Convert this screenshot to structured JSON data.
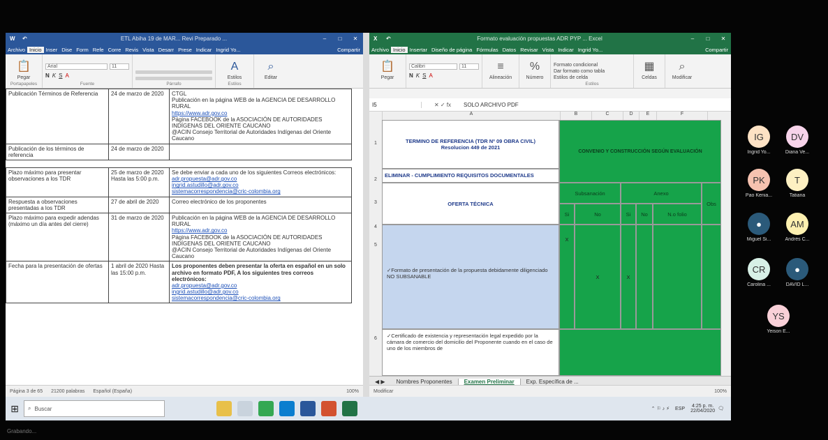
{
  "word": {
    "title": "ETL Abiha 19 de MAR... Revi Preparado ...",
    "tabs": [
      "Archivo",
      "Inicio",
      "Inser",
      "Dise",
      "Form",
      "Refe",
      "Corre",
      "Revis",
      "Vista",
      "Desarr",
      "Prese",
      "Indicar",
      "Ingrid Yo...",
      "Compartir"
    ],
    "ribbon": {
      "paste": "Pegar",
      "font": "Arial",
      "size": "11",
      "styles": "Estilos",
      "edit": "Editar",
      "clipboard": "Portapapeles",
      "font_group": "Fuente",
      "paragraph": "Párrafo",
      "styles_group": "Estilos"
    },
    "rows1": [
      {
        "c1": "Publicación Términos de Referencia",
        "c2": "24 de marzo de 2020",
        "c3": [
          "CTGL",
          "Publicación en la página WEB de la AGENCIA DE DESARROLLO RURAL",
          "https://www.adr.gov.co",
          "Página FACEBOOK de la ASOCIACIÓN DE AUTORIDADES INDÍGENAS DEL ORIENTE CAUCANO",
          "@ACIN Consejo Territorial de Autoridades Indígenas del Oriente Caucano"
        ]
      },
      {
        "c1": "Publicación de los términos de referencia",
        "c2": "24 de marzo de 2020",
        "c3": []
      }
    ],
    "rows2": [
      {
        "c1": "Plazo máximo para presentar observaciones a los TDR",
        "c2": "25 de marzo de 2020 Hasta las 5:00 p.m.",
        "c3": [
          "Se debe enviar a cada uno de los siguientes Correos electrónicos:",
          "adr.propuesta@adr.gov.co",
          "ingrid.astudillo@adr.gov.co",
          "sistemacorrespondencia@cric-colombia.org"
        ]
      },
      {
        "c1": "Respuesta a observaciones presentadas a los TDR",
        "c2": "27 de abril de 2020",
        "c3": [
          "Correo electrónico de los proponentes"
        ]
      },
      {
        "c1": "Plazo máximo para expedir adendas (máximo un día antes del cierre)",
        "c2": "31 de marzo de 2020",
        "c3": [
          "Publicación en la página WEB de la AGENCIA DE DESARROLLO RURAL",
          "https://www.adr.gov.co",
          "Página FACEBOOK de la ASOCIACIÓN DE AUTORIDADES INDÍGENAS DEL ORIENTE CAUCANO",
          "@ACIN Consejo Territorial de Autoridades Indígenas del Oriente Caucano"
        ]
      },
      {
        "c1": "Fecha para la presentación de ofertas",
        "c2": "1 abril de 2020 Hasta las 15:00 p.m.",
        "c3": [
          "Los proponentes deben presentar la oferta en español en un solo archivo en formato PDF, A los siguientes tres correos electrónicos:",
          "adr.propuesta@adr.gov.co",
          "ingrid.astudillo@adr.gov.co",
          "sistemacorrespondencia@cric-colombia.org"
        ]
      }
    ],
    "status": {
      "page": "Página 3 de 65",
      "words": "21200 palabras",
      "lang": "Español (España)",
      "zoom": "100%"
    }
  },
  "excel": {
    "title": "Formato evaluación propuestas ADR PYP ... Excel",
    "tabs": [
      "Archivo",
      "Inicio",
      "Insertar",
      "Diseño de página",
      "Fórmulas",
      "Datos",
      "Revisar",
      "Vista",
      "Indicar",
      "Ingrid Yo...",
      "Compartir"
    ],
    "ribbon": {
      "paste": "Pegar",
      "font": "Calibri",
      "size": "11",
      "align": "Alineación",
      "number": "Número",
      "cond": "Formato condicional",
      "table": "Dar formato como tabla",
      "cellstyles": "Estilos de celda",
      "cells": "Celdas",
      "edit": "Modificar",
      "styles_group": "Estilos"
    },
    "namebox": "I5",
    "formula": "SOLO ARCHIVO PDF",
    "cols": [
      "A",
      "B",
      "C",
      "D",
      "E",
      "F"
    ],
    "rows": [
      "1",
      "2",
      "3",
      "4",
      "5",
      "6"
    ],
    "a1_title": "TERMINO DE REFERENCIA (TDR Nº 09 OBRA CIVIL)",
    "a1_sub": "Resolucion 449 de 2021",
    "green_head": "CONVENIO Y CONSTRUCCIÓN SEGÚN EVALUACIÓN",
    "a2": "ELIMINAR - CUMPLIMIENTO REQUISITOS DOCUMENTALES",
    "a3": "OFERTA TÉCNICA",
    "sub_h1": "Subsanación",
    "sub_h2": "Anexo",
    "sub_si": "Si",
    "sub_no": "No",
    "sub_si2": "Si",
    "sub_no2": "No",
    "sub_folio": "N.o folio",
    "obs": "Obs",
    "a5": "✓Formato de presentación de la propuesta debidamente diligenciado NO SUBSANABLE",
    "x1": "X",
    "x2": "X",
    "x3": "X",
    "a6": "✓Certificado de existencia y representación legal expedido por la cámara de comercio del domicilio del Proponente cuando en el caso de uno de los miembros de",
    "sheets": [
      "Nombres Proponentes",
      "Examen Preliminar",
      "Exp. Específica de ..."
    ],
    "status": "Modificar",
    "zoom": "100%"
  },
  "taskbar": {
    "search": "Buscar",
    "time": "4:25 p. m.",
    "date": "22/04/2020",
    "lang": "ESP"
  },
  "participants": [
    {
      "initials": "IG",
      "name": "Ingrid Yo...",
      "color": "#fde2c4"
    },
    {
      "initials": "DV",
      "name": "Diana Ve...",
      "color": "#f7d3ea"
    },
    {
      "initials": "PK",
      "name": "Pao Kenia...",
      "color": "#f6c2b0"
    },
    {
      "initials": "T",
      "name": "Tatiana",
      "color": "#fdf0c2"
    },
    {
      "initials": "",
      "name": "Miguel Si...",
      "color": "#2b5a7a",
      "icon": true
    },
    {
      "initials": "AM",
      "name": "Andrés C...",
      "color": "#fdf0b0"
    },
    {
      "initials": "CR",
      "name": "Carolina ...",
      "color": "#d7f0e6"
    },
    {
      "initials": "",
      "name": "DAVID L...",
      "color": "#2b5a7a",
      "icon": true
    },
    {
      "initials": "YS",
      "name": "Yeison E...",
      "color": "#f9d0d8"
    }
  ],
  "footer": "Grabando..."
}
